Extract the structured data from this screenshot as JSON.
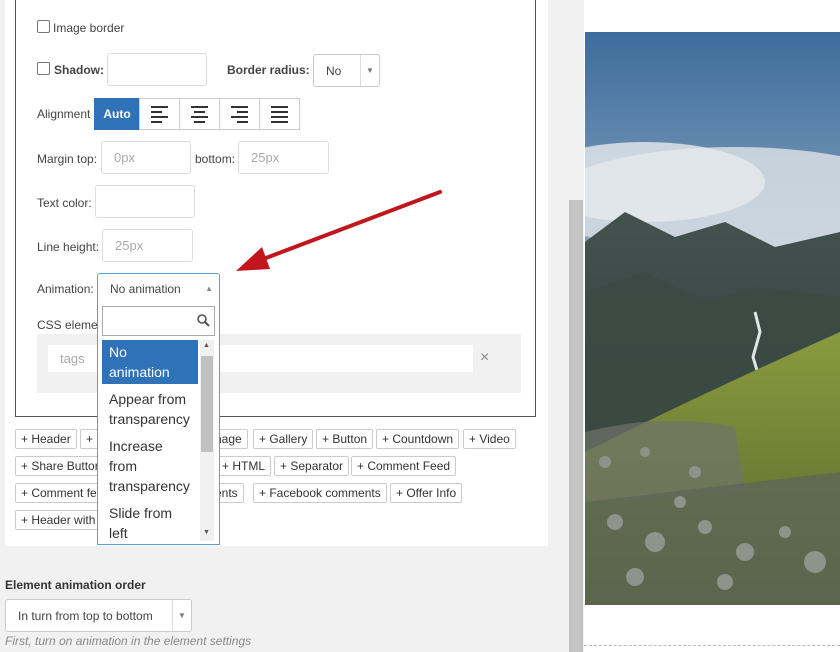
{
  "settings": {
    "image_border_label": "Image border",
    "shadow_label": "Shadow:",
    "shadow_value": "",
    "border_radius_label": "Border radius:",
    "border_radius_value": "No",
    "alignment_label": "Alignment",
    "alignment_auto": "Auto",
    "margin_top_label": "Margin top:",
    "margin_top_placeholder": "0px",
    "bottom_label": "bottom:",
    "bottom_placeholder": "25px",
    "text_color_label": "Text color:",
    "line_height_label": "Line height:",
    "line_height_placeholder": "25px",
    "animation_label": "Animation:",
    "animation_value": "No animation",
    "css_label": "CSS eleme",
    "tags_placeholder": "tags",
    "tags_clear": "×"
  },
  "dropdown": {
    "search_value": "",
    "options": [
      {
        "line1": "No",
        "line2": "animation"
      },
      {
        "line1": "Appear from",
        "line2": "transparency"
      },
      {
        "line1": "Increase",
        "line2": "from",
        "line3": "transparency"
      },
      {
        "line1": "Slide from",
        "line2": "left"
      }
    ],
    "selected_index": 0
  },
  "elements": {
    "row1": [
      "+ Header",
      "+",
      "nage",
      "+ Gallery",
      "+ Button",
      "+ Countdown",
      "+ Video"
    ],
    "row2": [
      "+ Share Button",
      "+ HTML",
      "+ Separator",
      "+ Comment Feed"
    ],
    "row3": [
      "+ Comment fe",
      "ents",
      "+ Facebook comments",
      "+ Offer Info"
    ],
    "row4": [
      "+ Header with"
    ]
  },
  "order": {
    "label": "Element animation order",
    "value": "In turn from top to bottom",
    "hint": "First, turn on animation in the element settings"
  },
  "colors": {
    "accent": "#2f72b7",
    "arrow": "#c0161c"
  }
}
